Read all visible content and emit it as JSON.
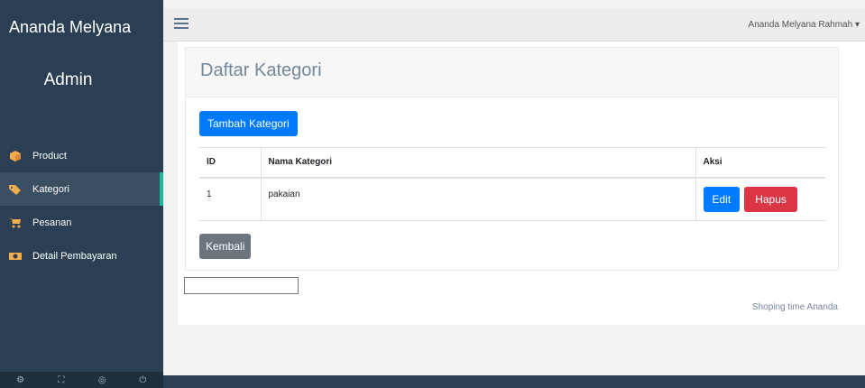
{
  "sidebar": {
    "brand": "Ananda Melyana",
    "role": "Admin",
    "items": [
      {
        "label": "Product",
        "icon": "cube-icon",
        "color": "#f0ad4e"
      },
      {
        "label": "Kategori",
        "icon": "tags-icon",
        "color": "#f0ad4e"
      },
      {
        "label": "Pesanan",
        "icon": "cart-icon",
        "color": "#f0ad4e"
      },
      {
        "label": "Detail Pembayaran",
        "icon": "money-icon",
        "color": "#f0ad4e"
      }
    ],
    "footer_icons": [
      "gear-icon",
      "fullscreen-icon",
      "eye-slash-icon",
      "power-icon"
    ]
  },
  "topnav": {
    "user_name": "Ananda Melyana Rahmah"
  },
  "panel": {
    "title": "Daftar Kategori",
    "add_button": "Tambah Kategori",
    "back_button": "Kembali",
    "table": {
      "headers": [
        "ID",
        "Nama Kategori",
        "Aksi"
      ],
      "rows": [
        {
          "id": "1",
          "nama": "pakaian",
          "edit": "Edit",
          "hapus": "Hapus"
        }
      ]
    }
  },
  "footer": {
    "text": "Shoping time Ananda"
  },
  "colors": {
    "sidebar": "#2a3f54",
    "active_border": "#1abb9c",
    "primary": "#007bff",
    "danger": "#dc3545",
    "secondary": "#6c757d"
  }
}
